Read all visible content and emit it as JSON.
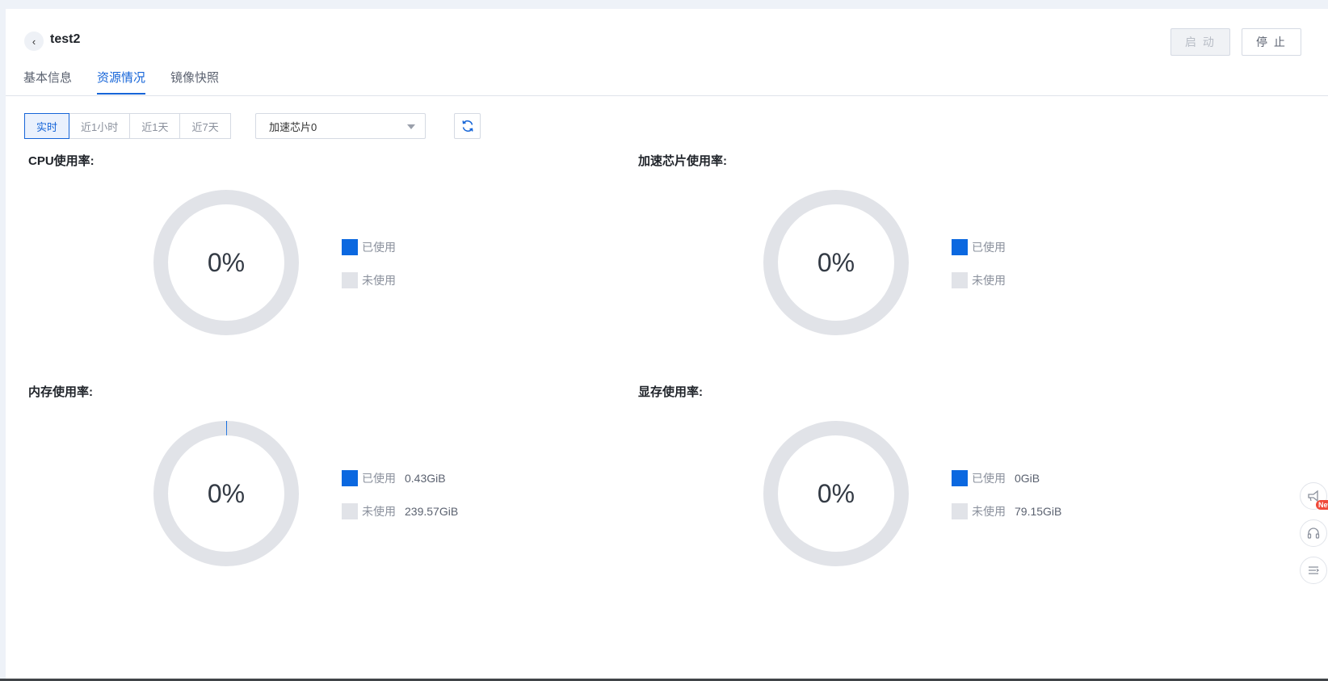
{
  "header": {
    "back_icon": "chevron-left-icon",
    "title": "test2",
    "start_label": "启 动",
    "stop_label": "停 止"
  },
  "tabs": [
    {
      "label": "基本信息",
      "active": false
    },
    {
      "label": "资源情况",
      "active": true
    },
    {
      "label": "镜像快照",
      "active": false
    }
  ],
  "toolbar": {
    "ranges": [
      {
        "label": "实时",
        "active": true
      },
      {
        "label": "近1小时",
        "active": false
      },
      {
        "label": "近1天",
        "active": false
      },
      {
        "label": "近7天",
        "active": false
      }
    ],
    "chip_select": "加速芯片0",
    "refresh_icon": "refresh-icon"
  },
  "charts": [
    {
      "title": "CPU使用率:",
      "percent_label": "0%",
      "used_label": "已使用",
      "used_value": "",
      "unused_label": "未使用",
      "unused_value": ""
    },
    {
      "title": "加速芯片使用率:",
      "percent_label": "0%",
      "used_label": "已使用",
      "used_value": "",
      "unused_label": "未使用",
      "unused_value": ""
    },
    {
      "title": "内存使用率:",
      "percent_label": "0%",
      "used_label": "已使用",
      "used_value": "0.43GiB",
      "unused_label": "未使用",
      "unused_value": "239.57GiB"
    },
    {
      "title": "显存使用率:",
      "percent_label": "0%",
      "used_label": "已使用",
      "used_value": "0GiB",
      "unused_label": "未使用",
      "unused_value": "79.15GiB"
    }
  ],
  "chart_data": [
    {
      "type": "pie",
      "title": "CPU使用率:",
      "categories": [
        "已使用",
        "未使用"
      ],
      "values": [
        0,
        100
      ],
      "unit": "%"
    },
    {
      "type": "pie",
      "title": "加速芯片使用率:",
      "categories": [
        "已使用",
        "未使用"
      ],
      "values": [
        0,
        100
      ],
      "unit": "%"
    },
    {
      "type": "pie",
      "title": "内存使用率:",
      "categories": [
        "已使用",
        "未使用"
      ],
      "values": [
        0.43,
        239.57
      ],
      "unit": "GiB"
    },
    {
      "type": "pie",
      "title": "显存使用率:",
      "categories": [
        "已使用",
        "未使用"
      ],
      "values": [
        0,
        79.15
      ],
      "unit": "GiB"
    }
  ],
  "colors": {
    "accent": "#1665d8",
    "used": "#0b68e0",
    "unused": "#e1e3e8",
    "badge": "#f04a3a"
  },
  "floating": {
    "announce_icon": "megaphone-icon",
    "badge": "New",
    "support_icon": "headset-icon",
    "menu_icon": "list-menu-icon"
  }
}
